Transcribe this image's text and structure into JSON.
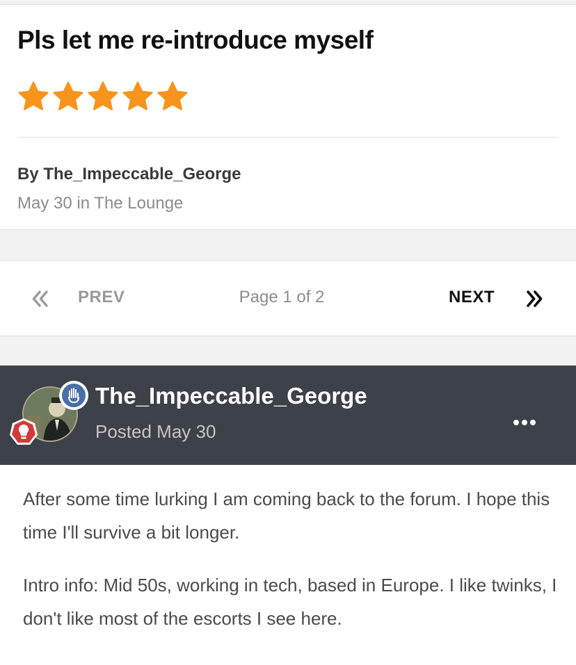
{
  "topic": {
    "title": "Pls let me re-introduce myself",
    "rating": {
      "value": 5,
      "max": 5,
      "star_color": "#f7941d"
    },
    "author_line": "By The_Impeccable_George",
    "meta_line": "May 30 in The Lounge"
  },
  "pagination": {
    "first_icon": "double-chevron-left-icon",
    "prev_label": "PREV",
    "status": "Page 1 of 2",
    "next_label": "NEXT",
    "last_icon": "double-chevron-right-icon"
  },
  "post": {
    "author": "The_Impeccable_George",
    "posted": "Posted May 30",
    "header_color": "#3d4149",
    "badges": [
      "hand-badge-icon",
      "lightbulb-rank-icon"
    ],
    "menu_icon": "more-horizontal-icon",
    "paragraphs": [
      "After some time lurking I am coming back to the forum. I hope this time I'll survive a bit longer.",
      "Intro info: Mid 50s, working in tech, based in Europe. I like twinks, I don't like most of the escorts I see here."
    ]
  }
}
